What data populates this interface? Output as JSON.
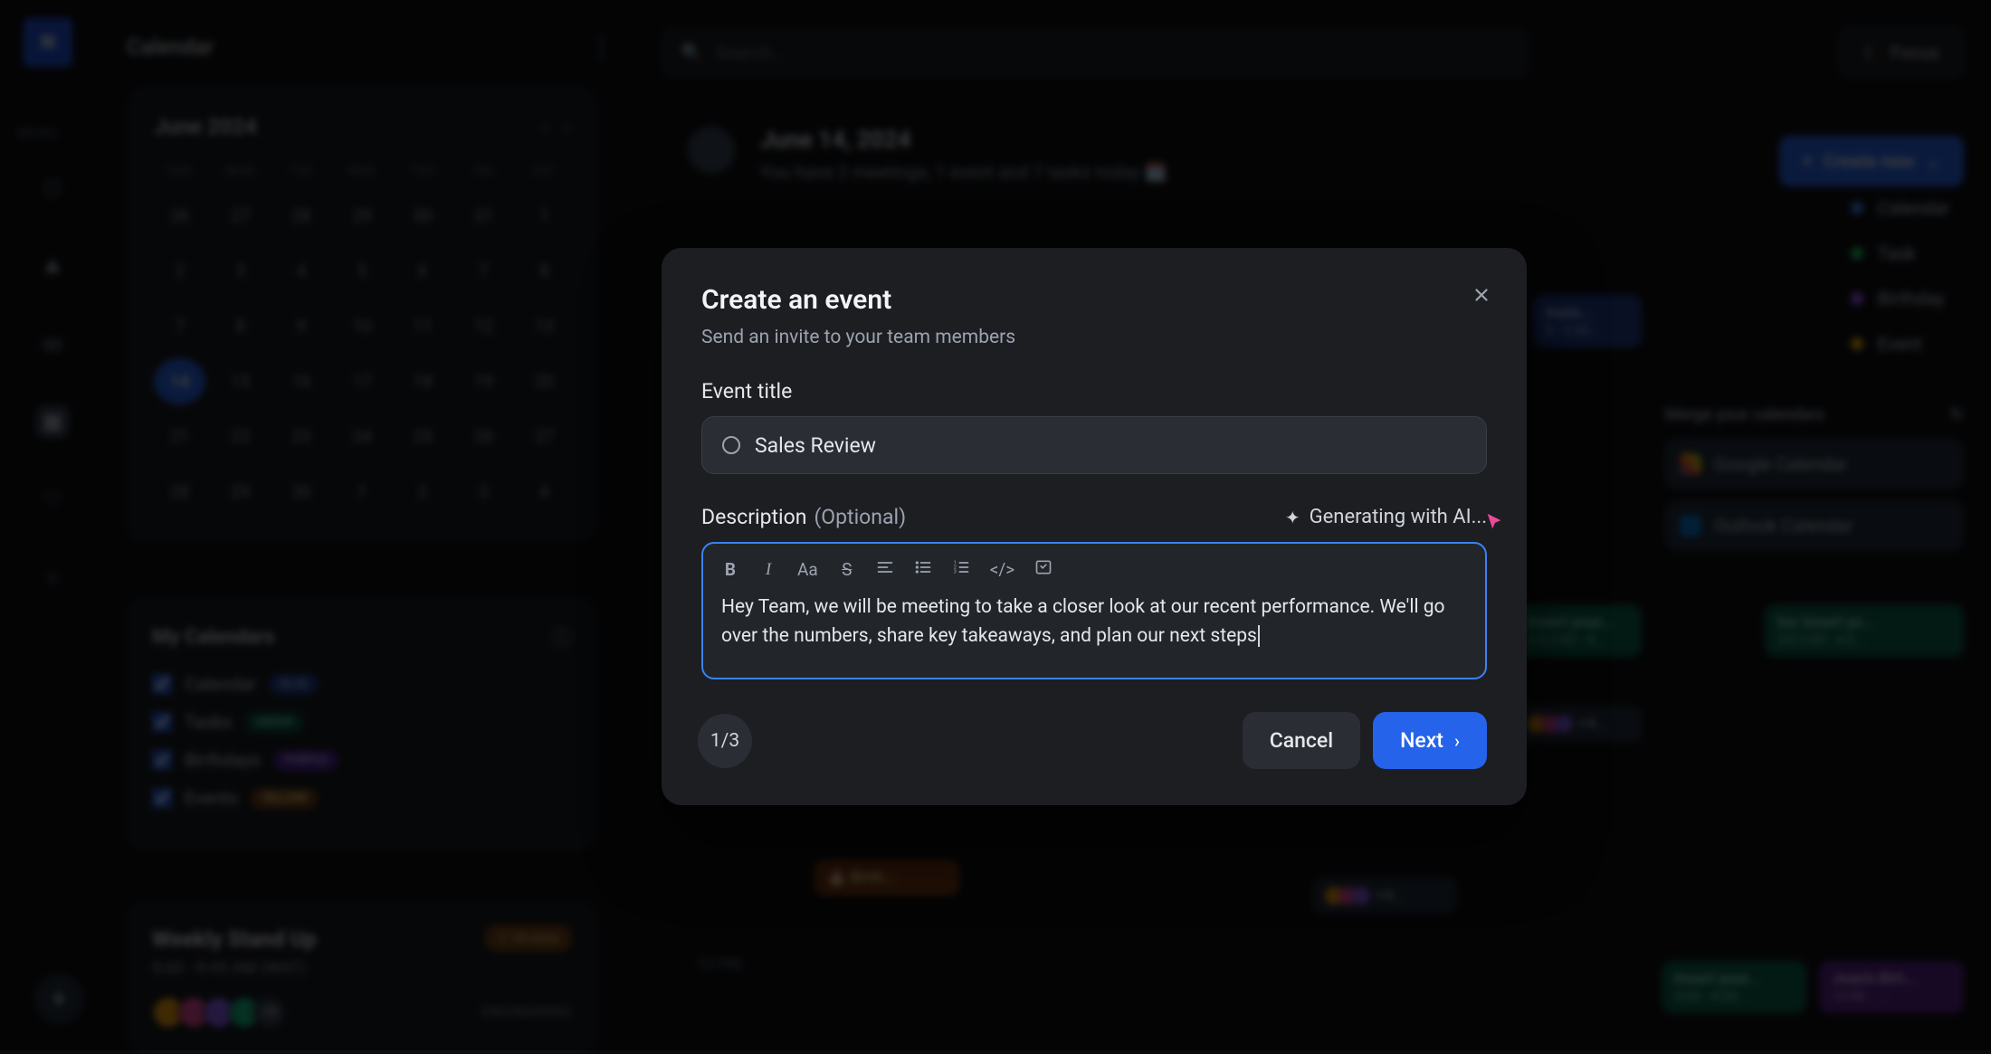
{
  "page": {
    "title": "Calendar",
    "menu_label": "MENU"
  },
  "search": {
    "placeholder": "Search..."
  },
  "focus_btn": "Focus",
  "create_btn": "Create new",
  "date_header": {
    "date": "June 14, 2024",
    "summary": "You have 2 meetings, 1 event and 7 tasks today 🗓️"
  },
  "minicalendar": {
    "month": "June 2024",
    "dow": [
      "SUN",
      "MON",
      "TUE",
      "WED",
      "THU",
      "FRI",
      "SAT"
    ],
    "rows": [
      [
        "26",
        "27",
        "28",
        "29",
        "30",
        "31",
        "1"
      ],
      [
        "2",
        "3",
        "4",
        "5",
        "6",
        "7",
        "8"
      ],
      [
        "7",
        "8",
        "9",
        "10",
        "11",
        "12",
        "13"
      ],
      [
        "14",
        "15",
        "16",
        "17",
        "18",
        "19",
        "20"
      ],
      [
        "21",
        "22",
        "23",
        "24",
        "25",
        "26",
        "27"
      ],
      [
        "28",
        "29",
        "30",
        "1",
        "2",
        "3",
        "4"
      ]
    ],
    "selected": "14"
  },
  "mycalendars": {
    "title": "My Calendars",
    "items": [
      {
        "name": "Calendar",
        "pill": "BLUE",
        "cls": "blue"
      },
      {
        "name": "Tasks",
        "pill": "GREEN",
        "cls": "green"
      },
      {
        "name": "Birthdays",
        "pill": "PURPLE",
        "cls": "purple"
      },
      {
        "name": "Events",
        "pill": "YELLOW",
        "cls": "yellow"
      }
    ]
  },
  "standup": {
    "title": "Weekly Stand Up",
    "time": "9:00 - 9:45 AM (WAT)",
    "badge": "⏱ 18 mins",
    "tag": "ENGINEERING",
    "avatar_more": "+9"
  },
  "legend": [
    {
      "label": "Calendar",
      "color": "#3b82f6"
    },
    {
      "label": "Task",
      "color": "#22c55e"
    },
    {
      "label": "Birthday",
      "color": "#a855f7"
    },
    {
      "label": "Event",
      "color": "#eab308"
    }
  ],
  "merge": {
    "title": "Merge your calendars",
    "google": "Google Calendar",
    "outlook": "Outlook Calendar"
  },
  "bg_events": {
    "e1": {
      "title": "Inste...",
      "time": "8 - 9:30..."
    },
    "e2": {
      "title": "Insert your...",
      "time": "3:0  3:00 - 4..."
    },
    "e3": {
      "title": "Ins  Insert yo...",
      "time": "3:0  3:00 - 4:3..."
    },
    "e4": {
      "title": "Insert your...",
      "time": "3:00 - 4:30..."
    },
    "e5": {
      "title": "Joan's Birt...",
      "time": "12:00 - ..."
    },
    "avatar_more": "+4..."
  },
  "modal": {
    "title": "Create an event",
    "subtitle": "Send an invite to your team members",
    "event_title_label": "Event title",
    "event_title_value": "Sales Review",
    "description_label": "Description",
    "optional": "(Optional)",
    "generating": "Generating with AI...",
    "body": "Hey Team, we will be meeting to take a closer look at our recent performance. We'll go over the numbers, share key takeaways, and plan our next steps",
    "step": "1/3",
    "cancel": "Cancel",
    "next": "Next"
  },
  "toolbar": {
    "bold": "B",
    "italic": "I",
    "case": "Aa",
    "strike": "S",
    "align": "≡",
    "ul": "•≡",
    "ol": "1≡",
    "code": "</>",
    "embed": "▦"
  }
}
